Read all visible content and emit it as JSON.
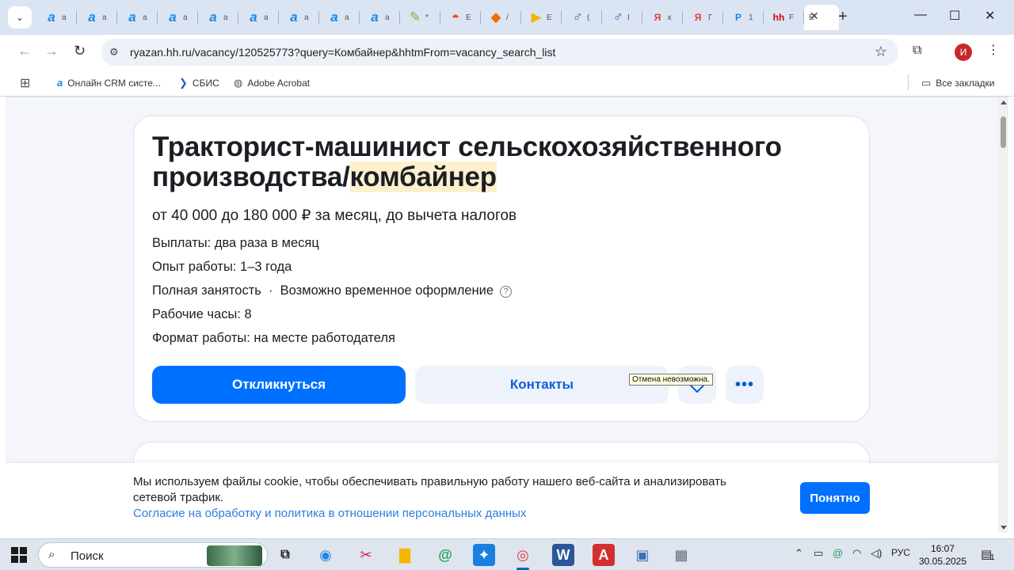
{
  "browser": {
    "tabs": [
      {
        "icon": "a",
        "label": "а"
      },
      {
        "icon": "a",
        "label": "а"
      },
      {
        "icon": "a",
        "label": "а"
      },
      {
        "icon": "a",
        "label": "а"
      },
      {
        "icon": "a",
        "label": "а"
      },
      {
        "icon": "a",
        "label": "а"
      },
      {
        "icon": "a",
        "label": "а"
      },
      {
        "icon": "a",
        "label": "а"
      },
      {
        "icon": "a",
        "label": "а"
      },
      {
        "icon": "✎",
        "label": "*"
      },
      {
        "icon": "◓",
        "label": "E"
      },
      {
        "icon": "◆",
        "label": "/"
      },
      {
        "icon": "▶",
        "label": "E"
      },
      {
        "icon": "♂",
        "label": "("
      },
      {
        "icon": "♂",
        "label": "I"
      },
      {
        "icon": "Я",
        "label": "к"
      },
      {
        "icon": "Я",
        "label": "Г"
      },
      {
        "icon": "Р",
        "label": "1"
      },
      {
        "icon": "hh",
        "label": "F"
      }
    ],
    "active_tab_label": "E",
    "url": "ryazan.hh.ru/vacancy/120525773?query=Комбайнер&hhtmFrom=vacancy_search_list",
    "profile_initial": "И",
    "bookmarks": [
      {
        "label": "Онлайн CRM систе..."
      },
      {
        "label": "СБИС"
      },
      {
        "label": "Adobe Acrobat"
      }
    ],
    "all_bookmarks_label": "Все закладки"
  },
  "vacancy": {
    "title_main": "Тракторист-машинист сельскохозяйственного производства/",
    "title_highlight": "комбайнер",
    "salary": "от 40 000 до 180 000 ₽ за месяц, до вычета налогов",
    "payments": "Выплаты: два раза в месяц",
    "experience": "Опыт работы: 1–3 года",
    "employment": "Полная занятость  ·  Возможно временное оформление",
    "hours": "Рабочие часы: 8",
    "work_format": "Формат работы: на месте работодателя",
    "apply_label": "Откликнуться",
    "contacts_label": "Контакты",
    "tooltip": "Отмена невозможна."
  },
  "cookie": {
    "text": "Мы используем файлы cookie, чтобы обеспечивать правильную работу нашего веб-сайта и анализировать сетевой трафик.",
    "link": "Согласие на обработку и политика в отношении персональных данных",
    "accept_label": "Понятно"
  },
  "taskbar": {
    "search_label": "Поиск",
    "lang": "РУС",
    "time": "16:07",
    "date": "30.05.2025",
    "notifications": "1"
  }
}
